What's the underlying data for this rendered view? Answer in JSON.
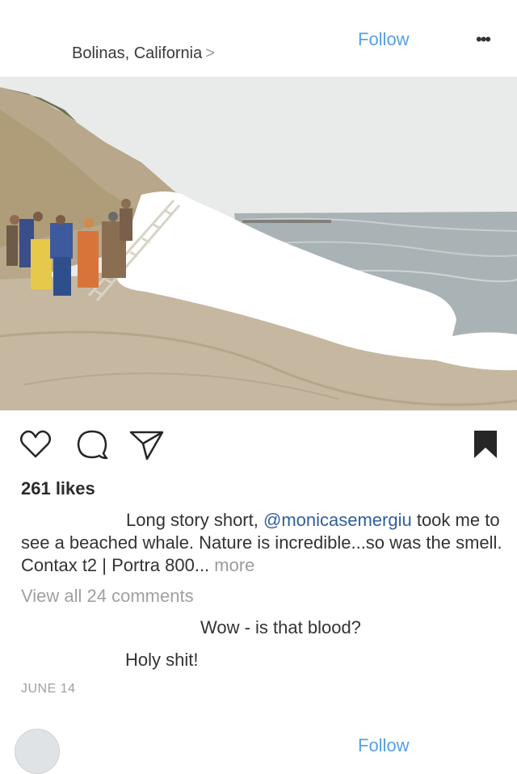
{
  "post": {
    "location": "Bolinas, California",
    "location_chevron": ">",
    "follow_label": "Follow",
    "more_label": "•••",
    "likes": "261 likes",
    "caption": {
      "text_before_mention": "Long story short, ",
      "mention": "@monicasemergiu",
      "text_after_mention": " took me to see a beached whale. Nature is incredible...so was the smell. Contax t2 | Portra 800...",
      "more_label": " more"
    },
    "view_comments": "View all 24 comments",
    "comments": [
      {
        "text": "Wow - is that blood?"
      },
      {
        "text": "Holy shit!"
      }
    ],
    "date": "JUNE 14"
  },
  "next_post": {
    "follow_label": "Follow"
  },
  "icons": {
    "like": "heart-icon",
    "comment": "comment-bubble-icon",
    "share": "paper-plane-icon",
    "save": "bookmark-icon"
  },
  "colors": {
    "accent_blue": "#56a0e3",
    "mention_blue": "#2f5f9e",
    "muted_gray": "#a0a0a0"
  }
}
